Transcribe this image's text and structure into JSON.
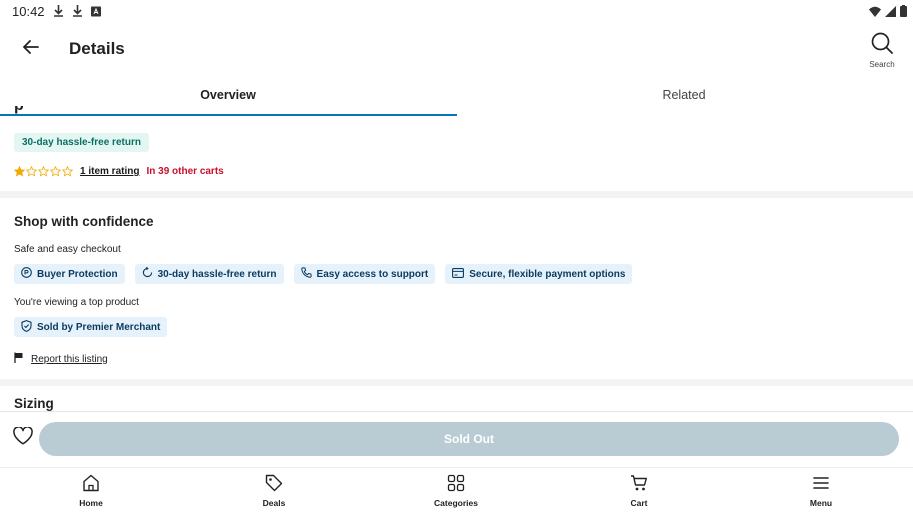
{
  "status_bar": {
    "time": "10:42"
  },
  "header": {
    "title": "Details",
    "search_label": "Search"
  },
  "tabs": [
    {
      "label": "Overview",
      "selected": true
    },
    {
      "label": "Related",
      "selected": false
    }
  ],
  "product": {
    "return_badge": "30-day hassle-free return",
    "rating_stars": 1,
    "rating_max": 5,
    "rating_link": "1 item rating",
    "carts_text": "In 39 other carts"
  },
  "confidence": {
    "title": "Shop with confidence",
    "checkout_label": "Safe and easy checkout",
    "badges": [
      {
        "icon": "buyer-protection-icon",
        "label": "Buyer Protection"
      },
      {
        "icon": "return-icon",
        "label": "30-day hassle-free return"
      },
      {
        "icon": "phone-icon",
        "label": "Easy access to support"
      },
      {
        "icon": "card-icon",
        "label": "Secure, flexible payment options"
      }
    ],
    "top_product_label": "You're viewing a top product",
    "merchant_badge": "Sold by Premier Merchant",
    "report_link": "Report this listing"
  },
  "sizing": {
    "title": "Sizing"
  },
  "action_bar": {
    "button_label": "Sold Out"
  },
  "bottom_nav": [
    {
      "icon": "home-icon",
      "label": "Home"
    },
    {
      "icon": "tag-icon",
      "label": "Deals"
    },
    {
      "icon": "grid-icon",
      "label": "Categories"
    },
    {
      "icon": "cart-icon",
      "label": "Cart"
    },
    {
      "icon": "menu-icon",
      "label": "Menu"
    }
  ],
  "colors": {
    "accent": "#0a74b8",
    "star": "#f2a900",
    "carts_text": "#c8102e",
    "badge_green_bg": "#e4f6f2",
    "badge_blue_bg": "#e5f2fb",
    "soldout_bg": "#b9cbd3"
  }
}
